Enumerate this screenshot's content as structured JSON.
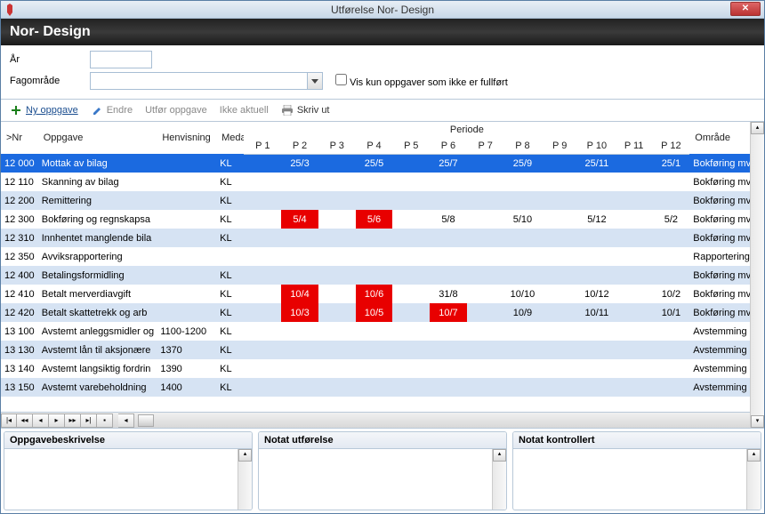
{
  "window": {
    "title": "Utførelse Nor- Design"
  },
  "header": {
    "title": "Nor- Design"
  },
  "params": {
    "year_label": "År",
    "year_value": "",
    "area_label": "Fagområde",
    "area_value": "",
    "show_incomplete": "Vis kun oppgaver som ikke er fullført"
  },
  "toolbar": {
    "new_task": "Ny oppgave",
    "edit": "Endre",
    "perform": "Utfør oppgave",
    "not_relevant": "Ikke aktuell",
    "print": "Skriv ut"
  },
  "grid": {
    "period_header": "Periode",
    "cols": {
      "nr": ">Nr",
      "opp": "Oppgave",
      "hen": "Henvisning",
      "med": "Meda",
      "omr": "Område"
    },
    "periods": [
      "P 1",
      "P 2",
      "P 3",
      "P 4",
      "P 5",
      "P 6",
      "P 7",
      "P 8",
      "P 9",
      "P 10",
      "P 11",
      "P 12"
    ],
    "rows": [
      {
        "nr": "12 000",
        "opp": "Mottak av bilag",
        "hen": "",
        "med": "KL",
        "p": [
          "",
          "25/3",
          "",
          "25/5",
          "",
          "25/7",
          "",
          "25/9",
          "",
          "25/11",
          "",
          "25/1"
        ],
        "omr": "Bokføring mv",
        "sel": true,
        "red": [
          1,
          3
        ]
      },
      {
        "nr": "12 110",
        "opp": "Skanning av bilag",
        "hen": "",
        "med": "KL",
        "p": [
          "",
          "",
          "",
          "",
          "",
          "",
          "",
          "",
          "",
          "",
          "",
          ""
        ],
        "omr": "Bokføring mv",
        "red": []
      },
      {
        "nr": "12 200",
        "opp": "Remittering",
        "hen": "",
        "med": "KL",
        "p": [
          "",
          "",
          "",
          "",
          "",
          "",
          "",
          "",
          "",
          "",
          "",
          ""
        ],
        "omr": "Bokføring mv",
        "red": []
      },
      {
        "nr": "12 300",
        "opp": "Bokføring og regnskapsa",
        "hen": "",
        "med": "KL",
        "p": [
          "",
          "5/4",
          "",
          "5/6",
          "",
          "5/8",
          "",
          "5/10",
          "",
          "5/12",
          "",
          "5/2"
        ],
        "omr": "Bokføring mv",
        "red": [
          1,
          3
        ]
      },
      {
        "nr": "12 310",
        "opp": "Innhentet manglende bila",
        "hen": "",
        "med": "KL",
        "p": [
          "",
          "",
          "",
          "",
          "",
          "",
          "",
          "",
          "",
          "",
          "",
          ""
        ],
        "omr": "Bokføring mv",
        "red": []
      },
      {
        "nr": "12 350",
        "opp": "Avviksrapportering",
        "hen": "",
        "med": "",
        "p": [
          "",
          "",
          "",
          "",
          "",
          "",
          "",
          "",
          "",
          "",
          "",
          ""
        ],
        "omr": "Rapportering",
        "red": []
      },
      {
        "nr": "12 400",
        "opp": "Betalingsformidling",
        "hen": "",
        "med": "KL",
        "p": [
          "",
          "",
          "",
          "",
          "",
          "",
          "",
          "",
          "",
          "",
          "",
          ""
        ],
        "omr": "Bokføring mv",
        "red": []
      },
      {
        "nr": "12 410",
        "opp": "Betalt merverdiavgift",
        "hen": "",
        "med": "KL",
        "p": [
          "",
          "10/4",
          "",
          "10/6",
          "",
          "31/8",
          "",
          "10/10",
          "",
          "10/12",
          "",
          "10/2"
        ],
        "omr": "Bokføring mv",
        "red": [
          1,
          3
        ]
      },
      {
        "nr": "12 420",
        "opp": "Betalt skattetrekk og arb",
        "hen": "",
        "med": "KL",
        "p": [
          "",
          "10/3",
          "",
          "10/5",
          "",
          "10/7",
          "",
          "10/9",
          "",
          "10/11",
          "",
          "10/1"
        ],
        "omr": "Bokføring mv",
        "red": [
          1,
          3,
          5
        ]
      },
      {
        "nr": "13 100",
        "opp": "Avstemt anleggsmidler og",
        "hen": "1100-1200",
        "med": "KL",
        "p": [
          "",
          "",
          "",
          "",
          "",
          "",
          "",
          "",
          "",
          "",
          "",
          ""
        ],
        "omr": "Avstemming o",
        "red": []
      },
      {
        "nr": "13 130",
        "opp": "Avstemt lån til aksjonære",
        "hen": "1370",
        "med": "KL",
        "p": [
          "",
          "",
          "",
          "",
          "",
          "",
          "",
          "",
          "",
          "",
          "",
          ""
        ],
        "omr": "Avstemming o",
        "red": []
      },
      {
        "nr": "13 140",
        "opp": "Avstemt langsiktig fordrin",
        "hen": "1390",
        "med": "KL",
        "p": [
          "",
          "",
          "",
          "",
          "",
          "",
          "",
          "",
          "",
          "",
          "",
          ""
        ],
        "omr": "Avstemming o",
        "red": []
      },
      {
        "nr": "13 150",
        "opp": "Avstemt varebeholdning",
        "hen": "1400",
        "med": "KL",
        "p": [
          "",
          "",
          "",
          "",
          "",
          "",
          "",
          "",
          "",
          "",
          "",
          ""
        ],
        "omr": "Avstemming o",
        "red": []
      }
    ]
  },
  "panels": {
    "p1": "Oppgavebeskrivelse",
    "p2": "Notat utførelse",
    "p3": "Notat kontrollert"
  }
}
